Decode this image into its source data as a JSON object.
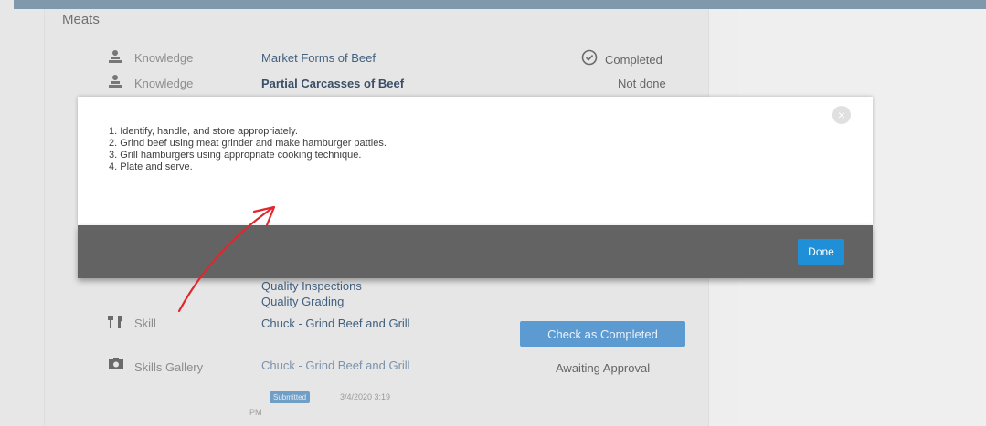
{
  "section": {
    "title": "Meats"
  },
  "rows": [
    {
      "type": "Knowledge",
      "link": "Market Forms of Beef",
      "status": "Completed",
      "icon": "knowledge-icon",
      "status_icon": "check-circle-icon"
    },
    {
      "type": "Knowledge",
      "link": "Partial Carcasses of Beef",
      "status": "Not done",
      "icon": "knowledge-icon"
    },
    {
      "type": "",
      "link_lines": [
        "Quality Inspections",
        "Quality Grading"
      ]
    },
    {
      "type": "Skill",
      "link": "Chuck - Grind Beef and Grill",
      "action": "Check as Completed",
      "icon": "utensils-icon"
    },
    {
      "type": "Skills Gallery",
      "link": "Chuck - Grind Beef and Grill",
      "status": "Awaiting Approval",
      "badge": "Submitted",
      "submitted_date": "3/4/2020 3:19",
      "submitted_ampm": "PM",
      "icon": "gallery-icon"
    }
  ],
  "modal": {
    "steps": [
      "1. Identify, handle, and store appropriately.",
      "2. Grind beef using meat grinder and make hamburger patties.",
      "3. Grill hamburgers using appropriate cooking technique.",
      "4. Plate and serve."
    ],
    "close_icon": "close-icon",
    "done_label": "Done"
  },
  "colors": {
    "accent_blue": "#1f8fd8",
    "link": "#42607f",
    "annotation_arrow": "#e1262c",
    "footer_gray": "#636363"
  }
}
